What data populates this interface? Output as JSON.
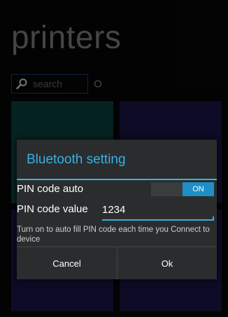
{
  "page": {
    "title": "printers"
  },
  "search": {
    "placeholder": "search"
  },
  "tiles": [
    {
      "color": "#0a4f47"
    },
    {
      "color": "#1d1a52"
    },
    {
      "color": "#1d1a52"
    },
    {
      "color": "#1d1a52"
    }
  ],
  "dialog": {
    "title": "Bluetooth setting",
    "pin_auto_label": "PIN code auto",
    "pin_auto_toggle": "ON",
    "pin_value_label": "PIN code value",
    "pin_value": "1234",
    "help_text": "Turn on to auto fill PIN code each time you Connect to device",
    "cancel_label": "Cancel",
    "ok_label": "Ok"
  },
  "icons": {
    "search": "search-icon",
    "refresh": "refresh-icon"
  },
  "colors": {
    "accent": "#34b2e4",
    "toggle_on": "#1f8fc8"
  }
}
